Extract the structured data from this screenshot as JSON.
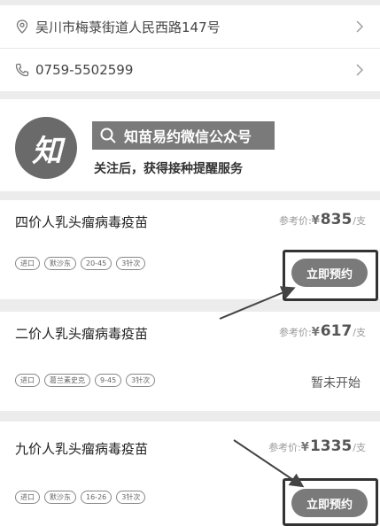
{
  "address": {
    "text": "吴川市梅菉街道人民西路147号",
    "icon": "location-icon"
  },
  "phone": {
    "text": "0759-5502599",
    "icon": "phone-icon"
  },
  "promo": {
    "logo": "知",
    "search_label": "知苗易约微信公众号",
    "subtitle": "关注后，获得接种提醒服务"
  },
  "vaccines": [
    {
      "name": "四价人乳头瘤病毒疫苗",
      "price_label": "参考价:",
      "currency": "¥",
      "price": "835",
      "unit": "/支",
      "tags": [
        "进口",
        "默沙东",
        "20-45",
        "3针次"
      ],
      "action": "立即预约"
    },
    {
      "name": "二价人乳头瘤病毒疫苗",
      "price_label": "参考价:",
      "currency": "¥",
      "price": "617",
      "unit": "/支",
      "tags": [
        "进口",
        "葛兰素史克",
        "9-45",
        "3针次"
      ],
      "action": "暂未开始"
    },
    {
      "name": "九价人乳头瘤病毒疫苗",
      "price_label": "参考价:",
      "currency": "¥",
      "price": "1335",
      "unit": "/支",
      "tags": [
        "进口",
        "默沙东",
        "16-26",
        "3针次"
      ],
      "action": "立即预约"
    }
  ],
  "colors": {
    "background": "#ececec",
    "button": "#7a7a7a",
    "card": "#ffffff"
  }
}
